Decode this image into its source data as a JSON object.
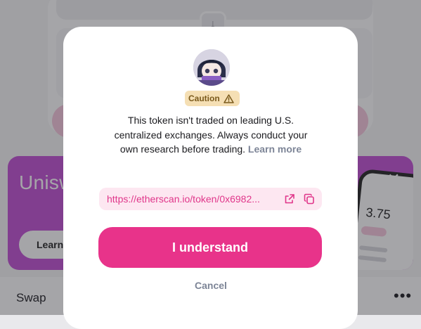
{
  "background": {
    "swap_arrow_icon": "arrow-down-icon",
    "promo": {
      "title": "Unisw",
      "button_label": "Learn",
      "close_icon": "close-icon",
      "phone_value": "3.75"
    },
    "bottom_bar": {
      "tab_label": "Swap",
      "more_icon": "more-dots-icon"
    }
  },
  "modal": {
    "badge_label": "Caution",
    "badge_icon": "warning-triangle-icon",
    "warning_text": "This token isn't traded on leading U.S. centralized exchanges. Always conduct your own research before trading.",
    "learn_more_label": "Learn more",
    "link_text": "https://etherscan.io/token/0x6982...",
    "open_link_icon": "external-link-icon",
    "copy_icon": "copy-icon",
    "primary_button": "I understand",
    "cancel_button": "Cancel"
  },
  "colors": {
    "accent": "#e8338a",
    "link_bg": "#fde7f1",
    "caution_bg": "#f5dfb4",
    "caution_text": "#7a5a1c",
    "promo_bg": "#c24fd4",
    "muted_text": "#7d8597"
  }
}
